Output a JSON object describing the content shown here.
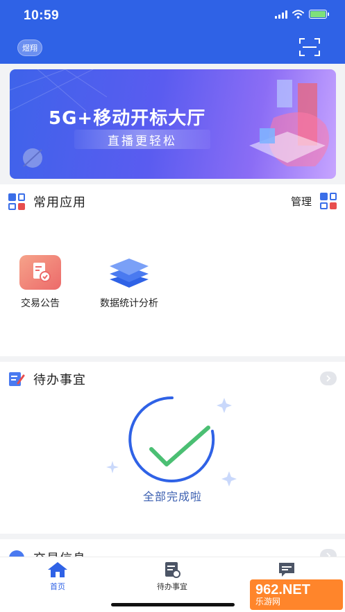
{
  "status": {
    "time": "10:59"
  },
  "header": {
    "avatar_text": "煜翔"
  },
  "banner": {
    "title": "5G+移动开标大厅",
    "subtitle": "直播更轻松"
  },
  "common_apps": {
    "title": "常用应用",
    "manage_label": "管理",
    "apps": [
      {
        "label": "交易公告",
        "icon": "document-check-icon"
      },
      {
        "label": "数据统计分析",
        "icon": "layers-icon"
      }
    ]
  },
  "todo": {
    "title": "待办事宜",
    "empty_text": "全部完成啦"
  },
  "trade_info": {
    "title": "交易信息"
  },
  "tabbar": {
    "items": [
      {
        "label": "首页",
        "icon": "home-icon",
        "active": true
      },
      {
        "label": "待办事宜",
        "icon": "todo-list-icon",
        "active": false
      },
      {
        "label": "",
        "icon": "message-icon",
        "active": false
      }
    ]
  },
  "watermark": {
    "big": "962.NET",
    "small": "乐游网"
  },
  "colors": {
    "brand": "#2f62e6",
    "accent_red": "#e84e4e",
    "check_green": "#4bbf73"
  }
}
